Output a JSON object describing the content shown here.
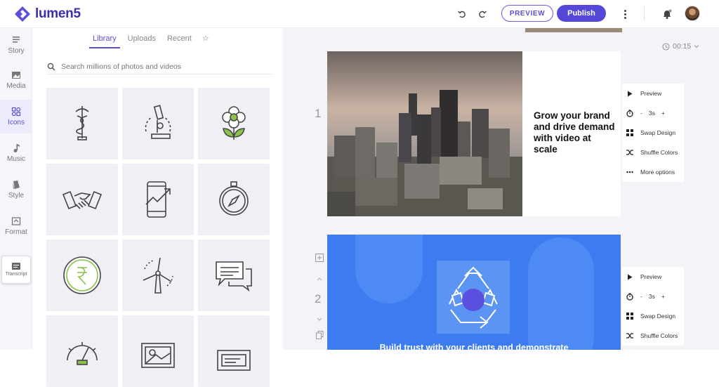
{
  "app": {
    "brand": "lumen5"
  },
  "header": {
    "preview_label": "PREVIEW",
    "publish_label": "Publish"
  },
  "rail": {
    "items": [
      {
        "label": "Story",
        "icon": "story-icon"
      },
      {
        "label": "Media",
        "icon": "media-icon"
      },
      {
        "label": "Icons",
        "icon": "icons-icon",
        "active": true
      },
      {
        "label": "Music",
        "icon": "music-icon"
      },
      {
        "label": "Style",
        "icon": "style-icon"
      },
      {
        "label": "Format",
        "icon": "format-icon"
      }
    ],
    "transcript_label": "Transcript"
  },
  "panel": {
    "tabs": [
      "Library",
      "Uploads",
      "Recent"
    ],
    "active_tab": "Library",
    "search_placeholder": "Search millions of photos and videos",
    "icons": [
      "caduceus-icon",
      "microscope-icon",
      "flower-icon",
      "handshake-icon",
      "phone-growth-icon",
      "compass-icon",
      "rupee-coin-icon",
      "wind-turbine-icon",
      "chat-bubbles-icon",
      "dashboard-gauge-icon",
      "picture-frame-icon",
      "screen-icon"
    ]
  },
  "timeline": {
    "duration": "00:15",
    "scenes": [
      {
        "number": "1",
        "headline": "Grow your brand and drive demand with video at scale"
      },
      {
        "number": "2",
        "caption": "Build trust with your clients and demonstrate"
      }
    ],
    "options": {
      "preview": "Preview",
      "duration_value": "3s",
      "minus": "-",
      "plus": "+",
      "swap_design": "Swap Design",
      "shuffle_colors": "Shuffle Colors",
      "more_options": "More options"
    }
  },
  "colors": {
    "accent": "#5448d8",
    "scene2_bg": "#3d7cf0"
  }
}
